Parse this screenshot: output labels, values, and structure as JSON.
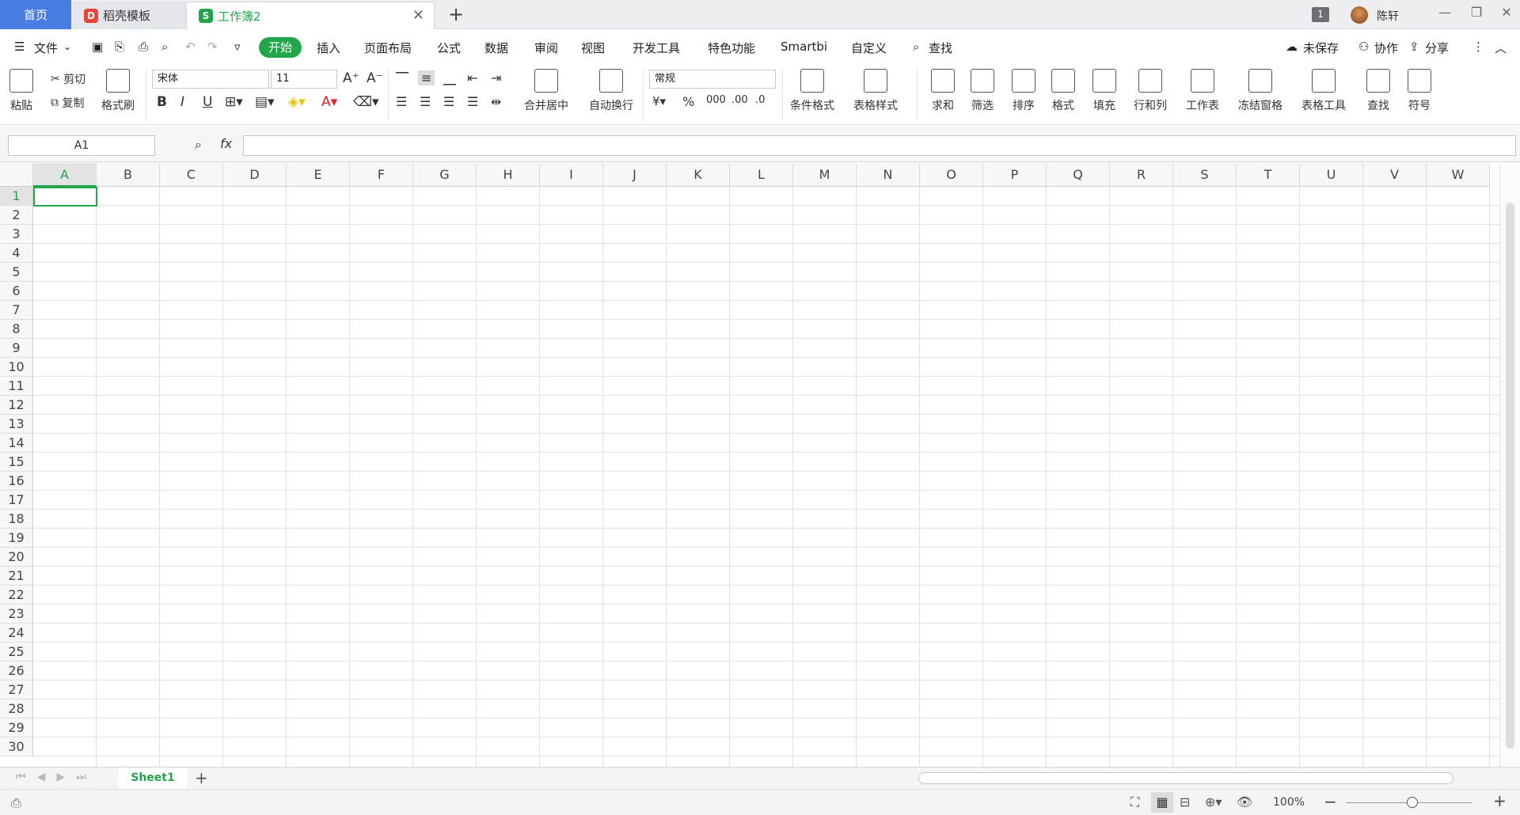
{
  "tabs": {
    "home": "首页",
    "template": "稻壳模板",
    "workbook": "工作簿2",
    "window_number": "1",
    "user": "陈轩"
  },
  "menu": {
    "file": "文件",
    "items": [
      "开始",
      "插入",
      "页面布局",
      "公式",
      "数据",
      "审阅",
      "视图",
      "开发工具",
      "特色功能",
      "Smartbi",
      "自定义"
    ],
    "search": "查找",
    "unsaved": "未保存",
    "collaborate": "协作",
    "share": "分享"
  },
  "toolbar": {
    "paste": "粘贴",
    "cut": "剪切",
    "copy": "复制",
    "format_painter": "格式刷",
    "font": "宋体",
    "font_size": "11",
    "merge": "合并居中",
    "wrap": "自动换行",
    "number_format": "常规",
    "cond_format": "条件格式",
    "table_style": "表格样式",
    "sum": "求和",
    "filter": "筛选",
    "sort": "排序",
    "format": "格式",
    "fill": "填充",
    "row_col": "行和列",
    "worksheet": "工作表",
    "freeze": "冻结窗格",
    "table_tools": "表格工具",
    "find": "查找",
    "symbol": "符号"
  },
  "formula": {
    "cell_ref": "A1",
    "fx": "fx"
  },
  "grid": {
    "columns": [
      "A",
      "B",
      "C",
      "D",
      "E",
      "F",
      "G",
      "H",
      "I",
      "J",
      "K",
      "L",
      "M",
      "N",
      "O",
      "P",
      "Q",
      "R",
      "S",
      "T",
      "U",
      "V",
      "W"
    ],
    "rows": [
      "1",
      "2",
      "3",
      "4",
      "5",
      "6",
      "7",
      "8",
      "9",
      "10",
      "11",
      "12",
      "13",
      "14",
      "15",
      "16",
      "17",
      "18",
      "19",
      "20",
      "21",
      "22",
      "23",
      "24",
      "25",
      "26",
      "27",
      "28",
      "29",
      "30"
    ]
  },
  "sheet": {
    "name": "Sheet1"
  },
  "status": {
    "zoom": "100%"
  },
  "colors": {
    "accent": "#23a54c",
    "home_tab": "#4a7de2"
  }
}
